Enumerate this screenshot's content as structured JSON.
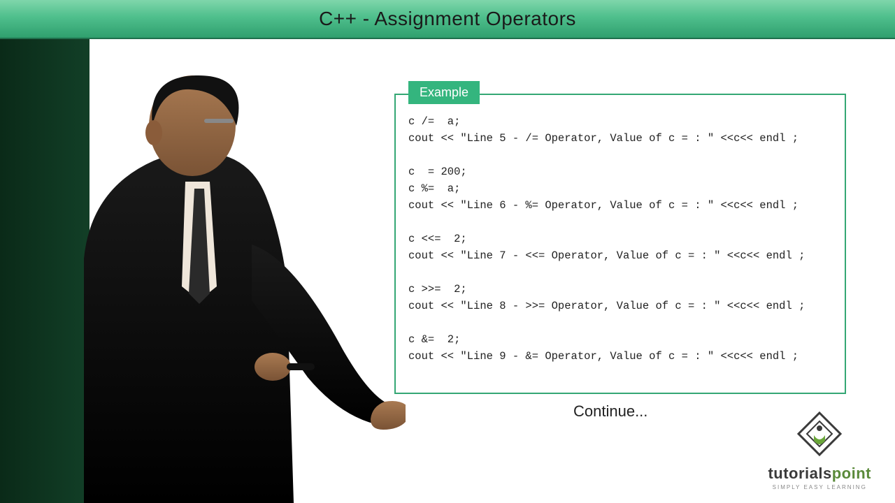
{
  "header": {
    "title": "C++ - Assignment Operators"
  },
  "example": {
    "tab_label": "Example",
    "code": "c /=  a;\ncout << \"Line 5 - /= Operator, Value of c = : \" <<c<< endl ;\n\nc  = 200;\nc %=  a;\ncout << \"Line 6 - %= Operator, Value of c = : \" <<c<< endl ;\n\nc <<=  2;\ncout << \"Line 7 - <<= Operator, Value of c = : \" <<c<< endl ;\n\nc >>=  2;\ncout << \"Line 8 - >>= Operator, Value of c = : \" <<c<< endl ;\n\nc &=  2;\ncout << \"Line 9 - &= Operator, Value of c = : \" <<c<< endl ;"
  },
  "continue_text": "Continue...",
  "logo": {
    "brand_primary": "tutorials",
    "brand_accent": "point",
    "tagline": "SIMPLY EASY LEARNING"
  },
  "colors": {
    "accent_green": "#34a774",
    "tab_green": "#34b57e",
    "titlebar_top": "#7fd6ab",
    "titlebar_bottom": "#2f9f6e"
  }
}
